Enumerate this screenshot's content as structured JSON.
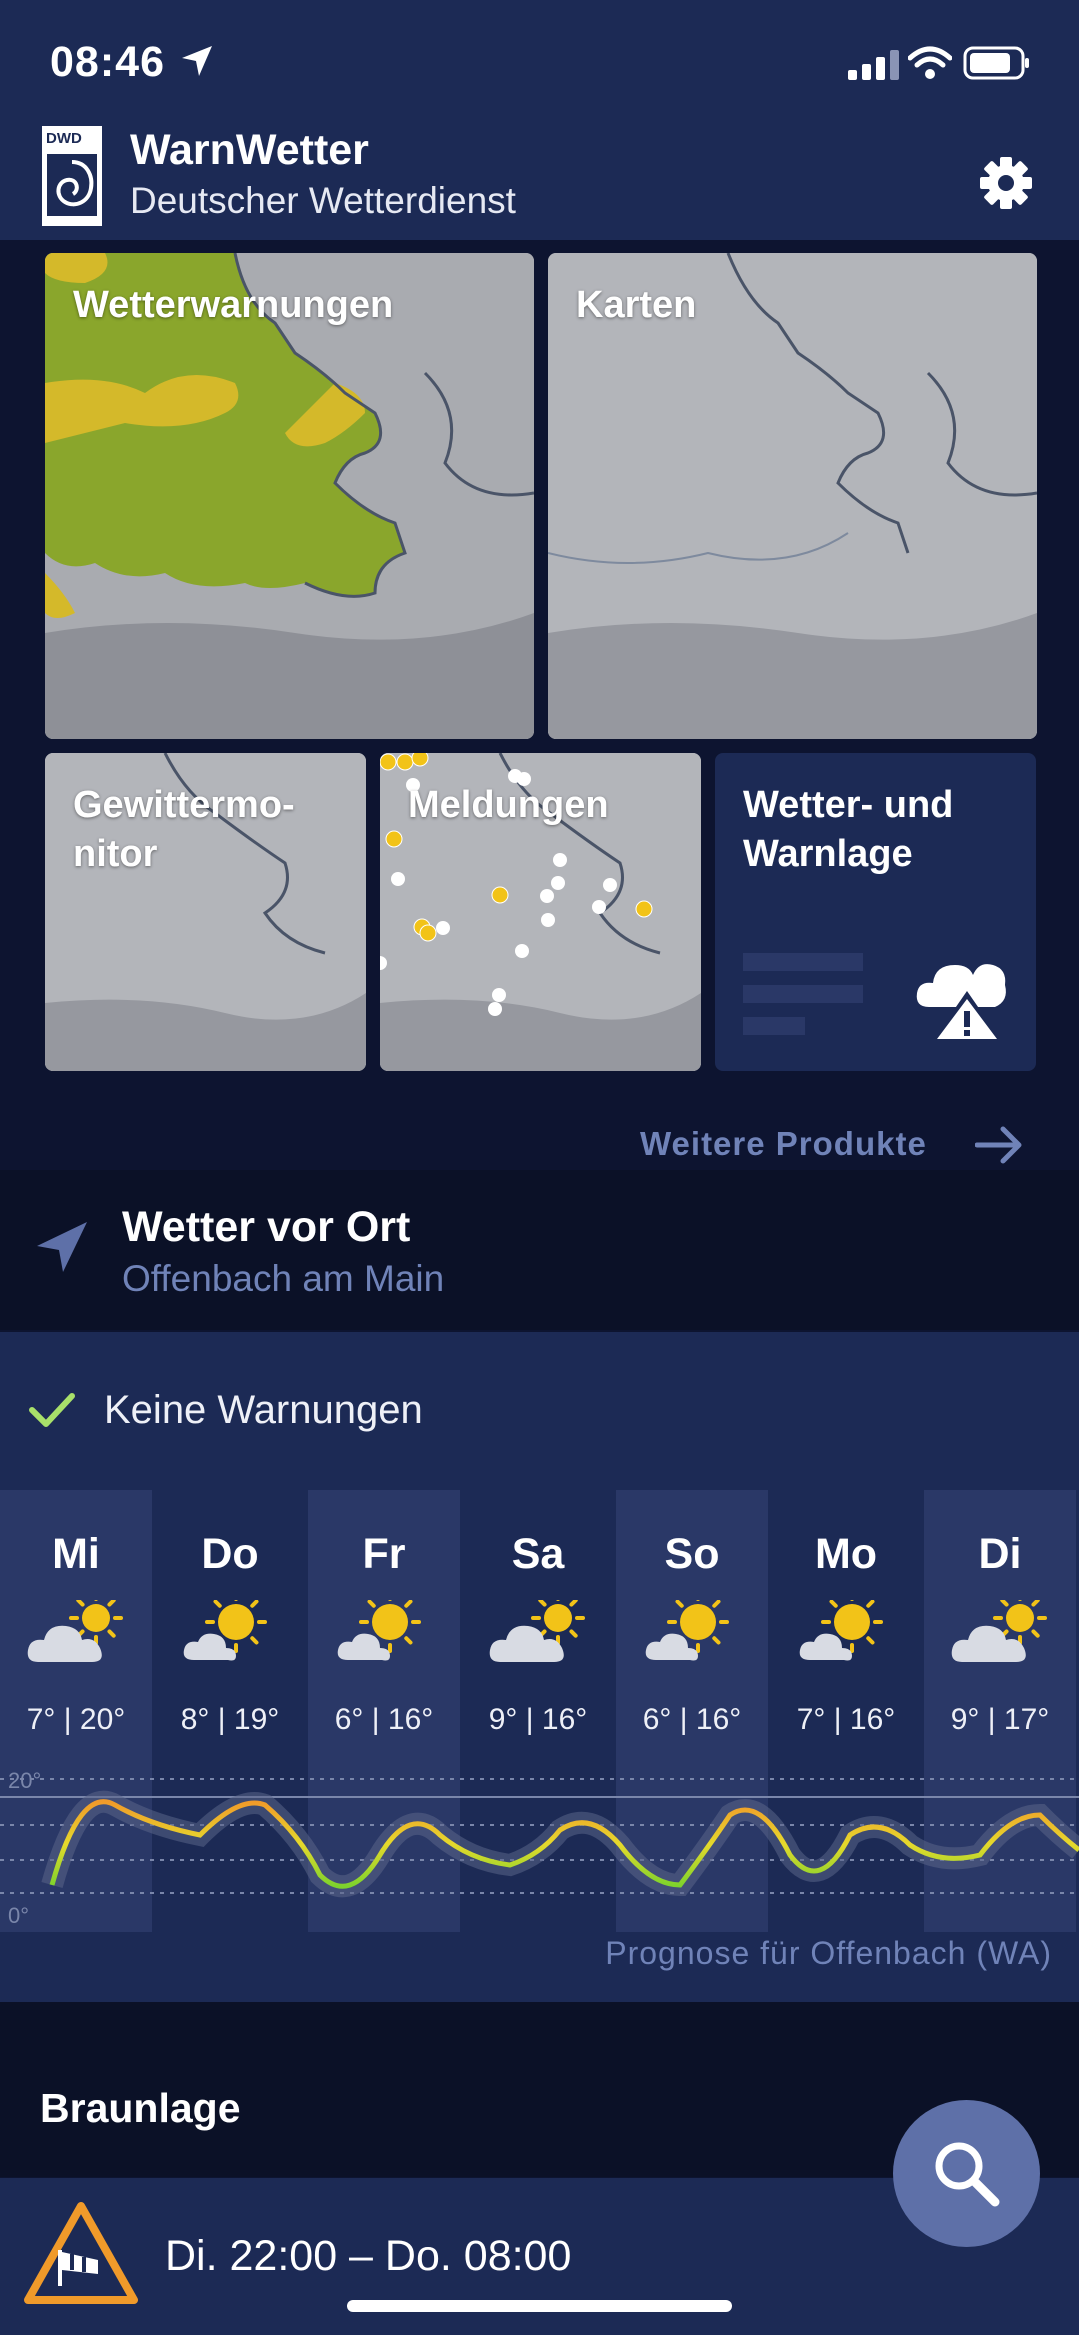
{
  "status_bar": {
    "time": "08:46"
  },
  "header": {
    "logo_text": "DWD",
    "title": "WarnWetter",
    "subtitle": "Deutscher Wetterdienst"
  },
  "tiles": {
    "wetterwarnungen": "Wetterwarnungen",
    "karten": "Karten",
    "gewittermonitor_line1": "Gewittermo-",
    "gewittermonitor_line2": "nitor",
    "meldungen": "Meldungen",
    "warnlage_line1": "Wetter- und",
    "warnlage_line2": "Warnlage"
  },
  "more_products": "Weitere Produkte",
  "location": {
    "title": "Wetter vor Ort",
    "city": "Offenbach am Main"
  },
  "warnings": {
    "status": "Keine Warnungen"
  },
  "forecast": {
    "days": [
      {
        "name": "Mi",
        "temps": "7° | 20°",
        "icon": "cloud-sun-icon"
      },
      {
        "name": "Do",
        "temps": "8° | 19°",
        "icon": "sun-cloud-icon"
      },
      {
        "name": "Fr",
        "temps": "6° | 16°",
        "icon": "sun-cloud-icon"
      },
      {
        "name": "Sa",
        "temps": "9° | 16°",
        "icon": "cloud-sun-icon"
      },
      {
        "name": "So",
        "temps": "6° | 16°",
        "icon": "sun-cloud-icon"
      },
      {
        "name": "Mo",
        "temps": "7° | 16°",
        "icon": "sun-cloud-icon"
      },
      {
        "name": "Di",
        "temps": "9° | 17°",
        "icon": "cloud-sun-icon"
      }
    ],
    "graph_label_top": "20°",
    "graph_label_bottom": "0°",
    "prognose": "Prognose für Offenbach (WA)"
  },
  "second_location": {
    "name": "Braunlage"
  },
  "alert": {
    "period": "Di. 22:00 – Do. 08:00",
    "icon": "wind-warning-icon"
  },
  "colors": {
    "header_bg": "#1c2a55",
    "page_bg": "#0d1430",
    "accent": "#7083b8",
    "check": "#a8e06a"
  }
}
